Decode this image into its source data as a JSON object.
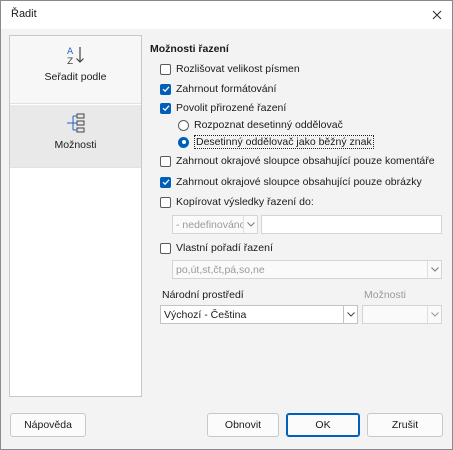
{
  "window": {
    "title": "Řadit"
  },
  "sidebar": {
    "items": [
      {
        "label": "Seřadit podle",
        "icon": "sort-az-icon"
      },
      {
        "label": "Možnosti",
        "icon": "tree-options-icon"
      }
    ]
  },
  "options": {
    "section_title": "Možnosti řazení",
    "case_sensitive": {
      "label": "Rozlišovat velikost písmen",
      "checked": false
    },
    "include_formats": {
      "label": "Zahrnout formátování",
      "checked": true
    },
    "natural_sort": {
      "label": "Povolit přirozené řazení",
      "checked": true
    },
    "radio_detect": {
      "label": "Rozpoznat desetinný oddělovač",
      "checked": false
    },
    "radio_normal": {
      "label": "Desetinný oddělovač jako běžný znak",
      "checked": true
    },
    "include_comments": {
      "label": "Zahrnout okrajové sloupce obsahující pouze komentáře",
      "checked": false
    },
    "include_images": {
      "label": "Zahrnout okrajové sloupce obsahující pouze obrázky",
      "checked": true
    },
    "copy_results": {
      "label": "Kopírovat výsledky řazení do:",
      "checked": false,
      "target_value": "- nedefinováno -"
    },
    "custom_order": {
      "label": "Vlastní pořadí řazení",
      "checked": false,
      "value": "po,út,st,čt,pá,so,ne"
    },
    "locale_label": "Národní prostředí",
    "locale_value": "Výchozí - Čeština",
    "algorithm_label": "Možnosti",
    "algorithm_value": ""
  },
  "buttons": {
    "help": "Nápověda",
    "reset": "Obnovit",
    "ok": "OK",
    "cancel": "Zrušit"
  },
  "colors": {
    "accent": "#005fb8",
    "dialog_bg": "#f3f3f3"
  }
}
